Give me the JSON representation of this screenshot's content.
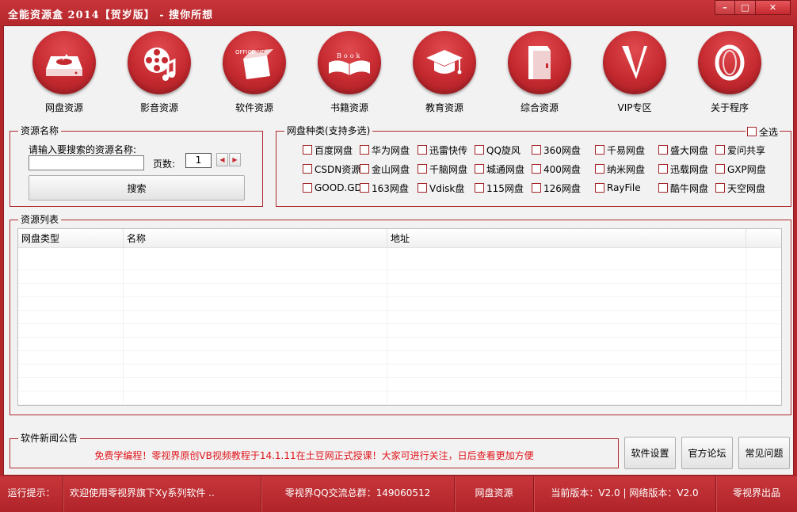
{
  "window": {
    "title": "全能资源盒 2014【贺岁版】 - 搜你所想",
    "minimize": "–",
    "maximize": "□",
    "close": "✕"
  },
  "toolbar": [
    {
      "name": "pan-resources",
      "label": "网盘资源",
      "icon": "hard-drive-icon"
    },
    {
      "name": "video-resources",
      "label": "影音资源",
      "icon": "film-reel-icon"
    },
    {
      "name": "software-resources",
      "label": "软件资源",
      "icon": "software-box-icon",
      "icon_text": [
        "OFFICE",
        "QQ"
      ]
    },
    {
      "name": "book-resources",
      "label": "书籍资源",
      "icon": "open-book-icon",
      "icon_text": [
        "Book"
      ]
    },
    {
      "name": "education-resources",
      "label": "教育资源",
      "icon": "graduation-cap-icon"
    },
    {
      "name": "general-resources",
      "label": "综合资源",
      "icon": "folder-icon"
    },
    {
      "name": "vip-zone",
      "label": "VIP专区",
      "icon": "vip-v-icon"
    },
    {
      "name": "about-program",
      "label": "关于程序",
      "icon": "globe-ring-icon"
    }
  ],
  "search": {
    "group_title": "资源名称",
    "prompt": "请输入要搜索的资源名称:",
    "value": "",
    "page_label": "页数:",
    "page_value": "1",
    "prev": "◀",
    "next": "▶",
    "search_button": "搜索"
  },
  "disk_types": {
    "group_title": "网盘种类(支持多选)",
    "select_all": "全选",
    "rows": [
      [
        "百度网盘",
        "华为网盘",
        "迅雷快传",
        "QQ旋风",
        "360网盘",
        "千易网盘",
        "盛大网盘",
        "爱问共享"
      ],
      [
        "CSDN资源",
        "金山网盘",
        "千脑网盘",
        "城通网盘",
        "400网盘",
        "纳米网盘",
        "迅载网盘",
        "GXP网盘"
      ],
      [
        "GOOD.GD",
        "163网盘",
        "Vdisk盘",
        "115网盘",
        "126网盘",
        "RayFile",
        "酷牛网盘",
        "天空网盘"
      ]
    ]
  },
  "results": {
    "group_title": "资源列表",
    "columns": [
      "网盘类型",
      "名称",
      "地址"
    ]
  },
  "news": {
    "group_title": "软件新闻公告",
    "text": "免费学编程！零视界原创VB视频教程于14.1.11在土豆网正式授课！大家可进行关注，日后查看更加方便",
    "text_color": "#e0141b",
    "buttons": [
      "软件设置",
      "官方论坛",
      "常见问题"
    ]
  },
  "status": {
    "label": "运行提示：",
    "message": "欢迎使用零视界旗下Xy系列软件 ..",
    "qq_group": "零视界QQ交流总群：149060512",
    "mode": "网盘资源",
    "version": "当前版本：V2.0 | 网络版本：V2.0",
    "credit": "零视界出品"
  },
  "colors": {
    "accent": "#c52a30",
    "border": "#b02a2e",
    "client_bg": "#f2f2f2"
  }
}
